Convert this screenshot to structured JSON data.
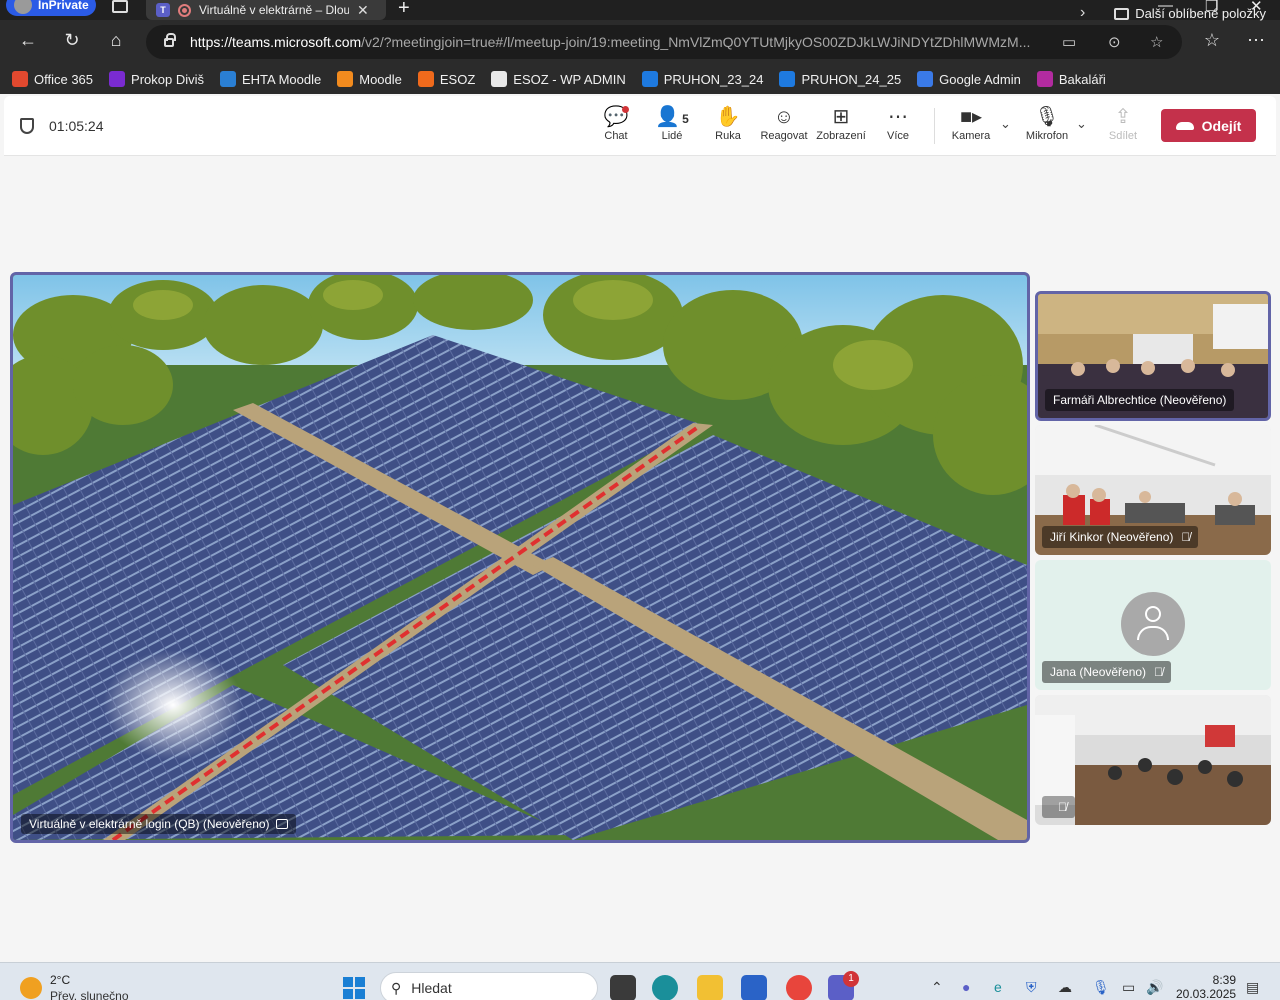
{
  "browser": {
    "inprivate_label": "InPrivate",
    "tab_title": "Virtuálně v elektrárně – Dlouh",
    "url_host": "https://teams.microsoft.com",
    "url_path": "/v2/?meetingjoin=true#/l/meetup-join/19:meeting_NmVlZmQ0YTUtMjkyOS00ZDJkLWJiNDYtZDhlMWMzM...",
    "favorites": [
      {
        "label": "Office 365",
        "color": "#e2492f"
      },
      {
        "label": "Prokop Diviš",
        "color": "#7a2bd1"
      },
      {
        "label": "EHTA Moodle",
        "color": "#2a7fd4"
      },
      {
        "label": "Moodle",
        "color": "#f28b1e"
      },
      {
        "label": "ESOZ",
        "color": "#f06a1c"
      },
      {
        "label": "ESOZ - WP ADMIN",
        "color": "#e8e8e8"
      },
      {
        "label": "PRUHON_23_24",
        "color": "#1e7ae0"
      },
      {
        "label": "PRUHON_24_25",
        "color": "#1e7ae0"
      },
      {
        "label": "Google Admin",
        "color": "#3a7ae8"
      },
      {
        "label": "Bakaláři",
        "color": "#b22ba0"
      }
    ],
    "favorites_more": "Další oblíbené položky"
  },
  "meeting": {
    "elapsed": "01:05:24",
    "toolbar": {
      "chat": "Chat",
      "people": "Lidé",
      "people_count": "5",
      "raise_hand": "Ruka",
      "react": "Reagovat",
      "view": "Zobrazení",
      "more": "Více",
      "camera": "Kamera",
      "microphone": "Mikrofon",
      "share": "Sdílet",
      "leave": "Odejít"
    },
    "main_participant": "Virtuálně v elektrárně login (QB) (Neověřeno)",
    "participants": [
      {
        "name": "Farmáři Albrechtice (Neověřeno)",
        "muted": false
      },
      {
        "name": "Jiří Kinkor (Neověřeno)",
        "muted": true
      },
      {
        "name": "Jana (Neověřeno)",
        "muted": true
      },
      {
        "name": "",
        "muted": true
      }
    ]
  },
  "taskbar": {
    "temperature": "2°C",
    "weather": "Přev. slunečno",
    "search_placeholder": "Hledat",
    "teams_badge": "1",
    "time": "8:39",
    "date": "20.03.2025"
  }
}
